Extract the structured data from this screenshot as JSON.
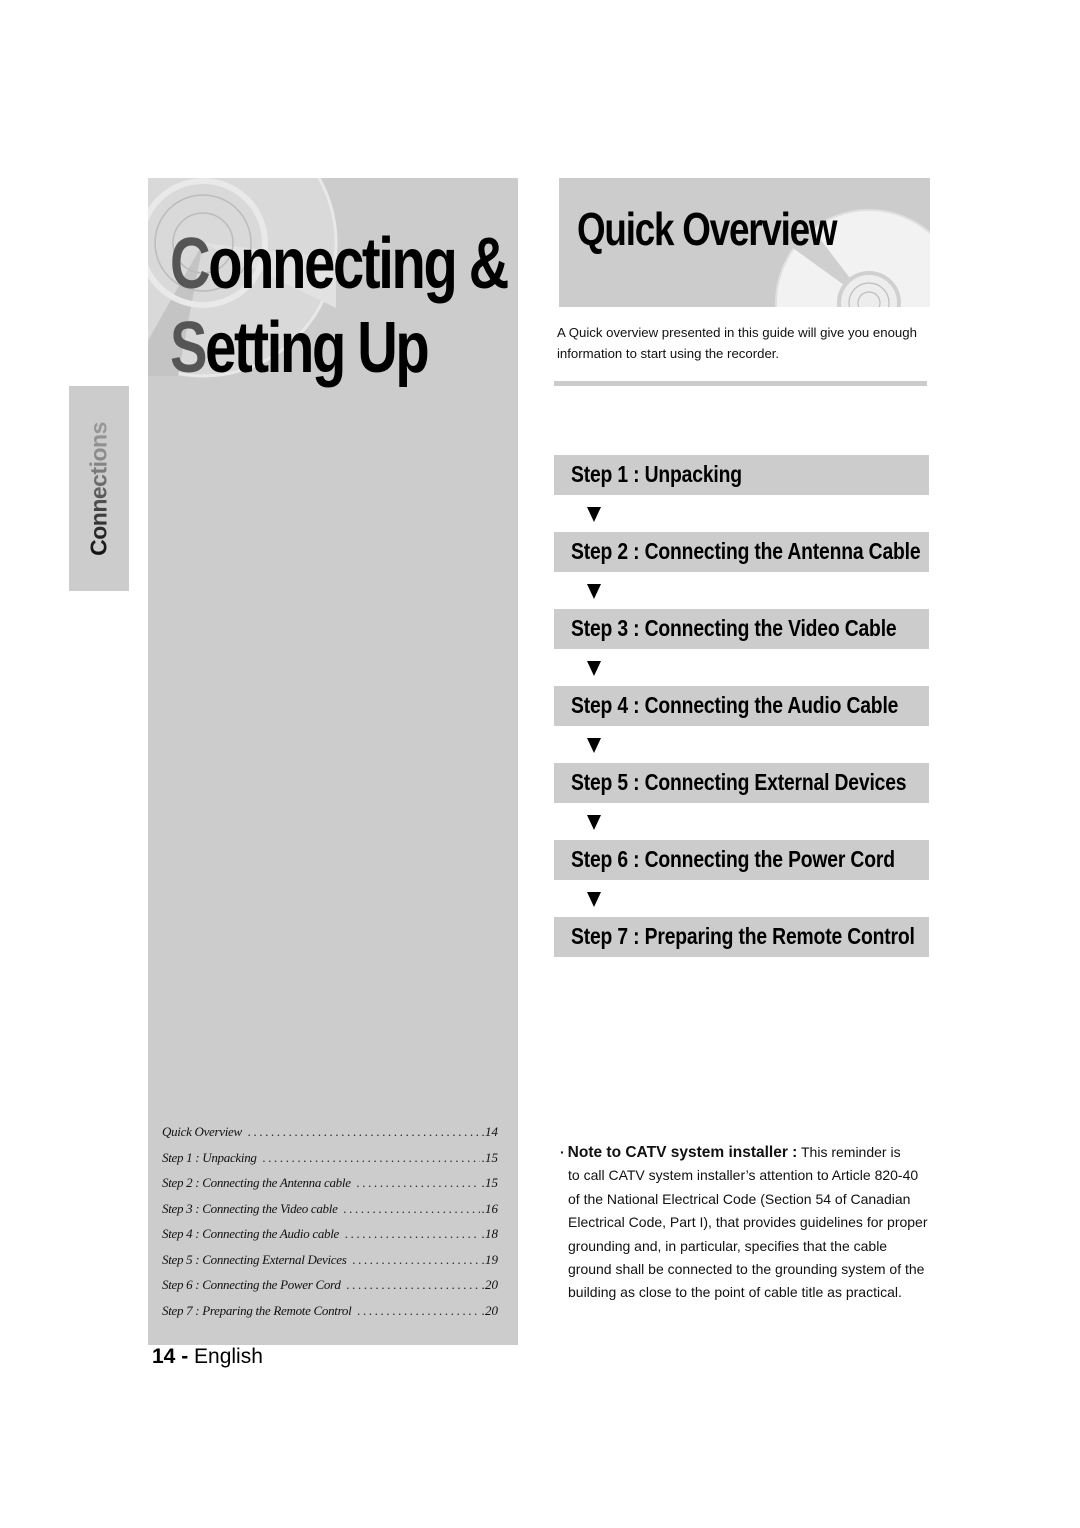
{
  "side_tab": {
    "label": "Connections"
  },
  "chapter": {
    "title_line1_initial": "C",
    "title_line1_rest": "onnecting &",
    "title_line2_initial": "S",
    "title_line2_rest": "etting Up",
    "toc": [
      {
        "label": "Quick Overview",
        "page": ".14"
      },
      {
        "label": "Step 1 : Unpacking",
        "page": ".15"
      },
      {
        "label": "Step 2 : Connecting the Antenna cable",
        "page": ".15"
      },
      {
        "label": "Step 3 : Connecting the Video cable",
        "page": ".16"
      },
      {
        "label": "Step 4 : Connecting the Audio cable",
        "page": ".18"
      },
      {
        "label": "Step 5 : Connecting External Devices",
        "page": ".19"
      },
      {
        "label": "Step 6 : Connecting the Power Cord",
        "page": ".20"
      },
      {
        "label": "Step 7 : Preparing the Remote Control",
        "page": ".20"
      }
    ]
  },
  "footer": {
    "page_number": "14 -",
    "language": "English"
  },
  "quick_overview": {
    "title": "Quick Overview",
    "intro": "A Quick overview presented in this guide will give you enough information to start using the recorder.",
    "steps": [
      {
        "label": "Step 1 : Unpacking"
      },
      {
        "label": "Step 2 : Connecting the Antenna Cable"
      },
      {
        "label": "Step 3 : Connecting the Video Cable"
      },
      {
        "label": "Step 4 : Connecting the Audio Cable"
      },
      {
        "label": "Step 5 : Connecting External Devices"
      },
      {
        "label": "Step 6 : Connecting the Power Cord"
      },
      {
        "label": "Step 7 : Preparing the Remote Control"
      }
    ],
    "arrow_icon": "down-triangle-icon"
  },
  "note": {
    "bullet": "·",
    "heading": "Note to CATV system installer :",
    "body_first": "This reminder is",
    "body_rest": "to call CATV system installer’s attention to Article 820-40 of the National Electrical Code (Section 54 of Canadian Electrical Code, Part I), that provides guidelines for proper grounding and, in particular, specifies that the cable ground shall be connected to the grounding system of the building as close to the point of cable title as practical."
  },
  "colors": {
    "panel_gray": "#cccccc",
    "initial_gray": "#555555",
    "text": "#000000"
  }
}
